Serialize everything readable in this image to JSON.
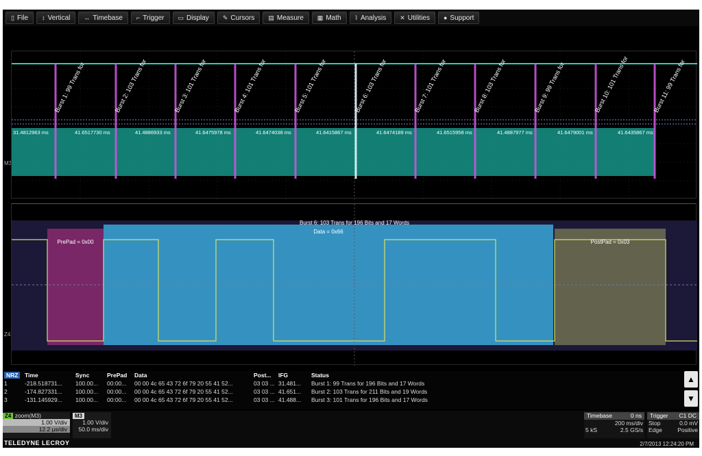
{
  "menu": [
    {
      "icon": "file-icon",
      "glyph": "▯",
      "label": "File"
    },
    {
      "icon": "vertical-icon",
      "glyph": "↕",
      "label": "Vertical"
    },
    {
      "icon": "timebase-icon",
      "glyph": "↔",
      "label": "Timebase"
    },
    {
      "icon": "trigger-icon",
      "glyph": "⌐",
      "label": "Trigger"
    },
    {
      "icon": "display-icon",
      "glyph": "▭",
      "label": "Display"
    },
    {
      "icon": "cursors-icon",
      "glyph": "✎",
      "label": "Cursors"
    },
    {
      "icon": "measure-icon",
      "glyph": "▤",
      "label": "Measure"
    },
    {
      "icon": "math-icon",
      "glyph": "▦",
      "label": "Math"
    },
    {
      "icon": "analysis-icon",
      "glyph": "⌇",
      "label": "Analysis"
    },
    {
      "icon": "utilities-icon",
      "glyph": "✕",
      "label": "Utilities"
    },
    {
      "icon": "support-icon",
      "glyph": "●",
      "label": "Support"
    }
  ],
  "top_trace": {
    "burst_labels": [
      "Burst 1: 99 Trans for",
      "Burst 2: 103 Trans for",
      "Burst 3: 101 Trans for",
      "Burst 4: 101 Trans for",
      "Burst 5: 101 Trans for",
      "Burst 6: 103 Trans for",
      "Burst 7: 101 Trans for",
      "Burst 8: 103 Trans for",
      "Burst 9: 99 Trans for",
      "Burst 10: 101 Trans for",
      "Burst 11: 99 Trans for"
    ],
    "intervals": [
      "31.4812963 ms",
      "41.6517730 ms",
      "41.4886933 ms",
      "41.6475978 ms",
      "41.6474038 ms",
      "41.6415867 ms",
      "41.6474189 ms",
      "41.6515958 ms",
      "41.4887977 ms",
      "41.6479001 ms",
      "41.6435867 ms"
    ],
    "channel_label": "M3"
  },
  "bottom_trace": {
    "burst_title": "Burst 6: 103 Trans for 196 Bits and 17 Words",
    "data_label": "Data = 0x66",
    "prepad_label": "PrePad = 0x00",
    "postpad_label": "PostPad = 0x03",
    "channel_label": "Z4"
  },
  "table": {
    "tag": "NRZ",
    "headers": [
      "Time",
      "Sync",
      "PrePad",
      "Data",
      "Post...",
      "IFG",
      "Status"
    ],
    "rows": [
      {
        "idx": "1",
        "time": "-218.518731...",
        "sync": "100.00...",
        "prepad": "00:00...",
        "data": "00 00 4c 65 43 72 6f 79 20 55 41 52...",
        "post": "03 03 ...",
        "ifg": "31.481...",
        "status": "Burst 1: 99 Trans for 196 Bits and 17 Words"
      },
      {
        "idx": "2",
        "time": "-174.827331...",
        "sync": "100.00...",
        "prepad": "00:00...",
        "data": "00 00 4c 65 43 72 6f 79 20 55 41 52...",
        "post": "03 03 ...",
        "ifg": "41.651...",
        "status": "Burst 2: 103 Trans for 211 Bits and 19 Words"
      },
      {
        "idx": "3",
        "time": "-131.145929...",
        "sync": "100.00...",
        "prepad": "00:00...",
        "data": "00 00 4c 65 43 72 6f 79 20 55 41 52...",
        "post": "03 03 ...",
        "ifg": "41.488...",
        "status": "Burst 3: 101 Trans for 196 Bits and 17 Words"
      }
    ]
  },
  "descriptors": {
    "z4_tag": "Z4",
    "z4_title": "zoom(M3)",
    "z4_vdiv": "1.00 V/div",
    "z4_tdiv": "12.2 µs/div",
    "m3_tag": "M3",
    "m3_vdiv": "1.00 V/div",
    "m3_tdiv": "50.0 ms/div",
    "timebase_title": "Timebase",
    "timebase_offset": "0 ns",
    "timebase_div": "200 ms/div",
    "timebase_samples": "5 kS",
    "timebase_rate": "2.5 GS/s",
    "trigger_title": "Trigger",
    "trigger_channels": "C1 DC",
    "trigger_mode": "Stop",
    "trigger_level": "0.0 mV",
    "trigger_type": "Edge",
    "trigger_slope": "Positive",
    "brand": "TELEDYNE LECROY",
    "datetime": "2/7/2013 12:24:20 PM"
  },
  "colors": {
    "teal": "#1aa89a",
    "pink": "#c855d8",
    "blue_box": "#3aa8d8",
    "prepad": "#8a2a70",
    "postpad": "#6a6a50",
    "trace": "#d8e068"
  }
}
